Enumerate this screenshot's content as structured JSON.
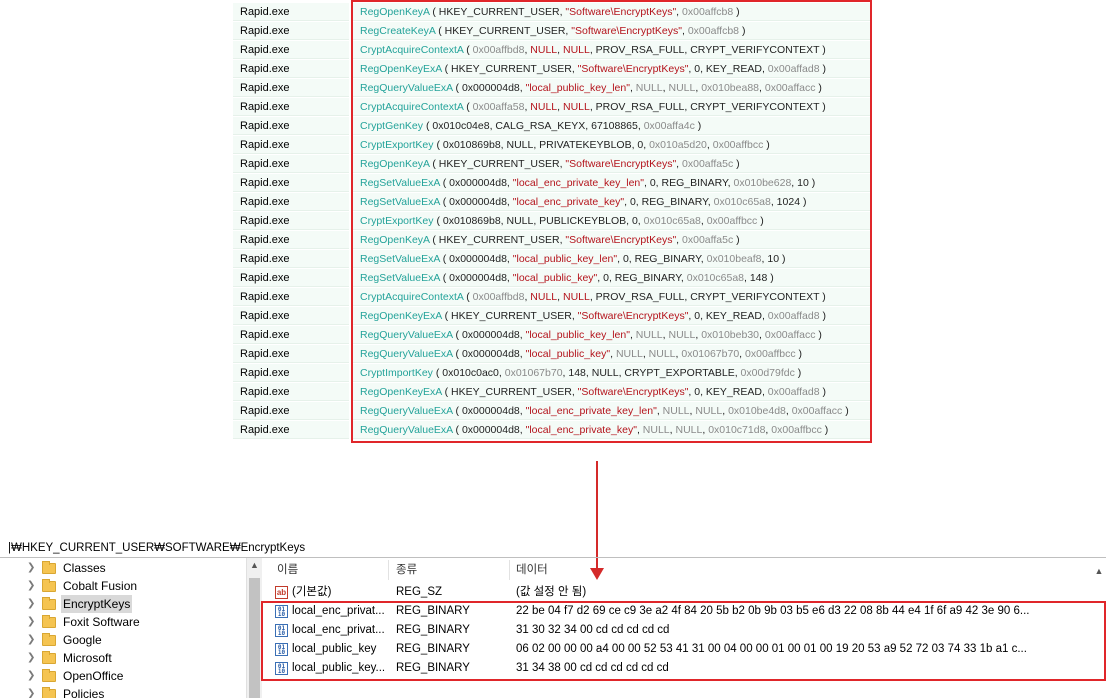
{
  "api_monitor": {
    "rows": [
      {
        "process": "Rapid.exe",
        "fn": "RegOpenKeyA",
        "args": [
          [
            "arg",
            " ( HKEY_CURRENT_USER, "
          ],
          [
            "str",
            "\"Software\\EncryptKeys\""
          ],
          [
            "arg",
            ", "
          ],
          [
            "hex",
            "0x00affcb8"
          ],
          [
            "arg",
            " )"
          ]
        ]
      },
      {
        "process": "Rapid.exe",
        "fn": "RegCreateKeyA",
        "args": [
          [
            "arg",
            " ( HKEY_CURRENT_USER, "
          ],
          [
            "str",
            "\"Software\\EncryptKeys\""
          ],
          [
            "arg",
            ", "
          ],
          [
            "hex",
            "0x00affcb8"
          ],
          [
            "arg",
            " )"
          ]
        ]
      },
      {
        "process": "Rapid.exe",
        "fn": "CryptAcquireContextA",
        "args": [
          [
            "arg",
            " ( "
          ],
          [
            "hex",
            "0x00affbd8"
          ],
          [
            "arg",
            ", "
          ],
          [
            "kw",
            "NULL"
          ],
          [
            "arg",
            ", "
          ],
          [
            "kw",
            "NULL"
          ],
          [
            "arg",
            ", PROV_RSA_FULL, CRYPT_VERIFYCONTEXT )"
          ]
        ]
      },
      {
        "process": "Rapid.exe",
        "fn": "RegOpenKeyExA",
        "args": [
          [
            "arg",
            " ( HKEY_CURRENT_USER, "
          ],
          [
            "str",
            "\"Software\\EncryptKeys\""
          ],
          [
            "arg",
            ", 0, KEY_READ, "
          ],
          [
            "hex",
            "0x00affad8"
          ],
          [
            "arg",
            " )"
          ]
        ]
      },
      {
        "process": "Rapid.exe",
        "fn": "RegQueryValueExA",
        "args": [
          [
            "arg",
            " ( 0x000004d8, "
          ],
          [
            "str",
            "\"local_public_key_len\""
          ],
          [
            "arg",
            ", "
          ],
          [
            "hex",
            "NULL"
          ],
          [
            "arg",
            ", "
          ],
          [
            "hex",
            "NULL"
          ],
          [
            "arg",
            ", "
          ],
          [
            "hex",
            "0x010bea88"
          ],
          [
            "arg",
            ", "
          ],
          [
            "hex",
            "0x00affacc"
          ],
          [
            "arg",
            " )"
          ]
        ]
      },
      {
        "process": "Rapid.exe",
        "fn": "CryptAcquireContextA",
        "args": [
          [
            "arg",
            " ( "
          ],
          [
            "hex",
            "0x00affa58"
          ],
          [
            "arg",
            ", "
          ],
          [
            "kw",
            "NULL"
          ],
          [
            "arg",
            ", "
          ],
          [
            "kw",
            "NULL"
          ],
          [
            "arg",
            ", PROV_RSA_FULL, CRYPT_VERIFYCONTEXT )"
          ]
        ]
      },
      {
        "process": "Rapid.exe",
        "fn": "CryptGenKey",
        "args": [
          [
            "arg",
            " ( 0x010c04e8, CALG_RSA_KEYX, 67108865, "
          ],
          [
            "hex",
            "0x00affa4c"
          ],
          [
            "arg",
            " )"
          ]
        ]
      },
      {
        "process": "Rapid.exe",
        "fn": "CryptExportKey",
        "args": [
          [
            "arg",
            " ( 0x010869b8, NULL, PRIVATEKEYBLOB, 0, "
          ],
          [
            "hex",
            "0x010a5d20"
          ],
          [
            "arg",
            ", "
          ],
          [
            "hex",
            "0x00affbcc"
          ],
          [
            "arg",
            " )"
          ]
        ]
      },
      {
        "process": "Rapid.exe",
        "fn": "RegOpenKeyA",
        "args": [
          [
            "arg",
            " ( HKEY_CURRENT_USER, "
          ],
          [
            "str",
            "\"Software\\EncryptKeys\""
          ],
          [
            "arg",
            ", "
          ],
          [
            "hex",
            "0x00affa5c"
          ],
          [
            "arg",
            " )"
          ]
        ]
      },
      {
        "process": "Rapid.exe",
        "fn": "RegSetValueExA",
        "args": [
          [
            "arg",
            " ( 0x000004d8, "
          ],
          [
            "str",
            "\"local_enc_private_key_len\""
          ],
          [
            "arg",
            ", 0, REG_BINARY, "
          ],
          [
            "hex",
            "0x010be628"
          ],
          [
            "arg",
            ", 10 )"
          ]
        ]
      },
      {
        "process": "Rapid.exe",
        "fn": "RegSetValueExA",
        "args": [
          [
            "arg",
            " ( 0x000004d8, "
          ],
          [
            "str",
            "\"local_enc_private_key\""
          ],
          [
            "arg",
            ", 0, REG_BINARY, "
          ],
          [
            "hex",
            "0x010c65a8"
          ],
          [
            "arg",
            ", 1024 )"
          ]
        ]
      },
      {
        "process": "Rapid.exe",
        "fn": "CryptExportKey",
        "args": [
          [
            "arg",
            " ( 0x010869b8, NULL, PUBLICKEYBLOB, 0, "
          ],
          [
            "hex",
            "0x010c65a8"
          ],
          [
            "arg",
            ", "
          ],
          [
            "hex",
            "0x00affbcc"
          ],
          [
            "arg",
            " )"
          ]
        ]
      },
      {
        "process": "Rapid.exe",
        "fn": "RegOpenKeyA",
        "args": [
          [
            "arg",
            " ( HKEY_CURRENT_USER, "
          ],
          [
            "str",
            "\"Software\\EncryptKeys\""
          ],
          [
            "arg",
            ", "
          ],
          [
            "hex",
            "0x00affa5c"
          ],
          [
            "arg",
            " )"
          ]
        ]
      },
      {
        "process": "Rapid.exe",
        "fn": "RegSetValueExA",
        "args": [
          [
            "arg",
            " ( 0x000004d8, "
          ],
          [
            "str",
            "\"local_public_key_len\""
          ],
          [
            "arg",
            ", 0, REG_BINARY, "
          ],
          [
            "hex",
            "0x010beaf8"
          ],
          [
            "arg",
            ", 10 )"
          ]
        ]
      },
      {
        "process": "Rapid.exe",
        "fn": "RegSetValueExA",
        "args": [
          [
            "arg",
            " ( 0x000004d8, "
          ],
          [
            "str",
            "\"local_public_key\""
          ],
          [
            "arg",
            ", 0, REG_BINARY, "
          ],
          [
            "hex",
            "0x010c65a8"
          ],
          [
            "arg",
            ", 148 )"
          ]
        ]
      },
      {
        "process": "Rapid.exe",
        "fn": "CryptAcquireContextA",
        "args": [
          [
            "arg",
            " ( "
          ],
          [
            "hex",
            "0x00affbd8"
          ],
          [
            "arg",
            ", "
          ],
          [
            "kw",
            "NULL"
          ],
          [
            "arg",
            ", "
          ],
          [
            "kw",
            "NULL"
          ],
          [
            "arg",
            ", PROV_RSA_FULL, CRYPT_VERIFYCONTEXT )"
          ]
        ]
      },
      {
        "process": "Rapid.exe",
        "fn": "RegOpenKeyExA",
        "args": [
          [
            "arg",
            " ( HKEY_CURRENT_USER, "
          ],
          [
            "str",
            "\"Software\\EncryptKeys\""
          ],
          [
            "arg",
            ", 0, KEY_READ, "
          ],
          [
            "hex",
            "0x00affad8"
          ],
          [
            "arg",
            " )"
          ]
        ]
      },
      {
        "process": "Rapid.exe",
        "fn": "RegQueryValueExA",
        "args": [
          [
            "arg",
            " ( 0x000004d8, "
          ],
          [
            "str",
            "\"local_public_key_len\""
          ],
          [
            "arg",
            ", "
          ],
          [
            "hex",
            "NULL"
          ],
          [
            "arg",
            ", "
          ],
          [
            "hex",
            "NULL"
          ],
          [
            "arg",
            ", "
          ],
          [
            "hex",
            "0x010beb30"
          ],
          [
            "arg",
            ", "
          ],
          [
            "hex",
            "0x00affacc"
          ],
          [
            "arg",
            " )"
          ]
        ]
      },
      {
        "process": "Rapid.exe",
        "fn": "RegQueryValueExA",
        "args": [
          [
            "arg",
            " ( 0x000004d8, "
          ],
          [
            "str",
            "\"local_public_key\""
          ],
          [
            "arg",
            ", "
          ],
          [
            "hex",
            "NULL"
          ],
          [
            "arg",
            ", "
          ],
          [
            "hex",
            "NULL"
          ],
          [
            "arg",
            ", "
          ],
          [
            "hex",
            "0x01067b70"
          ],
          [
            "arg",
            ", "
          ],
          [
            "hex",
            "0x00affbcc"
          ],
          [
            "arg",
            " )"
          ]
        ]
      },
      {
        "process": "Rapid.exe",
        "fn": "CryptImportKey",
        "args": [
          [
            "arg",
            " ( 0x010c0ac0, "
          ],
          [
            "hex",
            "0x01067b70"
          ],
          [
            "arg",
            ", 148, NULL, CRYPT_EXPORTABLE, "
          ],
          [
            "hex",
            "0x00d79fdc"
          ],
          [
            "arg",
            " )"
          ]
        ]
      },
      {
        "process": "Rapid.exe",
        "fn": "RegOpenKeyExA",
        "args": [
          [
            "arg",
            " ( HKEY_CURRENT_USER, "
          ],
          [
            "str",
            "\"Software\\EncryptKeys\""
          ],
          [
            "arg",
            ", 0, KEY_READ, "
          ],
          [
            "hex",
            "0x00affad8"
          ],
          [
            "arg",
            " )"
          ]
        ]
      },
      {
        "process": "Rapid.exe",
        "fn": "RegQueryValueExA",
        "args": [
          [
            "arg",
            " ( 0x000004d8, "
          ],
          [
            "str",
            "\"local_enc_private_key_len\""
          ],
          [
            "arg",
            ", "
          ],
          [
            "hex",
            "NULL"
          ],
          [
            "arg",
            ", "
          ],
          [
            "hex",
            "NULL"
          ],
          [
            "arg",
            ", "
          ],
          [
            "hex",
            "0x010be4d8"
          ],
          [
            "arg",
            ", "
          ],
          [
            "hex",
            "0x00affacc"
          ],
          [
            "arg",
            " )"
          ]
        ]
      },
      {
        "process": "Rapid.exe",
        "fn": "RegQueryValueExA",
        "args": [
          [
            "arg",
            " ( 0x000004d8, "
          ],
          [
            "str",
            "\"local_enc_private_key\""
          ],
          [
            "arg",
            ", "
          ],
          [
            "hex",
            "NULL"
          ],
          [
            "arg",
            ", "
          ],
          [
            "hex",
            "NULL"
          ],
          [
            "arg",
            ", "
          ],
          [
            "hex",
            "0x010c71d8"
          ],
          [
            "arg",
            ", "
          ],
          [
            "hex",
            "0x00affbcc"
          ],
          [
            "arg",
            " )"
          ]
        ]
      }
    ]
  },
  "registry": {
    "address": "|₩HKEY_CURRENT_USER₩SOFTWARE₩EncryptKeys",
    "tree": [
      {
        "label": "Classes",
        "selected": false
      },
      {
        "label": "Cobalt Fusion",
        "selected": false
      },
      {
        "label": "EncryptKeys",
        "selected": true
      },
      {
        "label": "Foxit Software",
        "selected": false
      },
      {
        "label": "Google",
        "selected": false
      },
      {
        "label": "Microsoft",
        "selected": false
      },
      {
        "label": "OpenOffice",
        "selected": false
      },
      {
        "label": "Policies",
        "selected": false
      }
    ],
    "columns": {
      "name": "이름",
      "type": "종류",
      "data": "데이터"
    },
    "values": [
      {
        "icon": "string",
        "name": "(기본값)",
        "type": "REG_SZ",
        "data": "(값 설정 안 됨)"
      },
      {
        "icon": "binary",
        "name": "local_enc_privat...",
        "type": "REG_BINARY",
        "data": "22 be 04 f7 d2 69 ce c9 3e a2 4f 84 20 5b b2 0b 9b 03 b5 e6 d3 22 08 8b 44 e4 1f 6f a9 42 3e 90 6..."
      },
      {
        "icon": "binary",
        "name": "local_enc_privat...",
        "type": "REG_BINARY",
        "data": "31 30 32 34 00 cd cd cd cd cd"
      },
      {
        "icon": "binary",
        "name": "local_public_key",
        "type": "REG_BINARY",
        "data": "06 02 00 00 00 a4 00 00 52 53 41 31 00 04 00 00 01 00 01 00 19 20 53 a9 52 72 03 74 33 1b a1 c..."
      },
      {
        "icon": "binary",
        "name": "local_public_key...",
        "type": "REG_BINARY",
        "data": "31 34 38 00 cd cd cd cd cd cd"
      }
    ]
  },
  "colors": {
    "highlight": "#e0262a",
    "function": "#24a39a",
    "string": "#b4141c"
  }
}
